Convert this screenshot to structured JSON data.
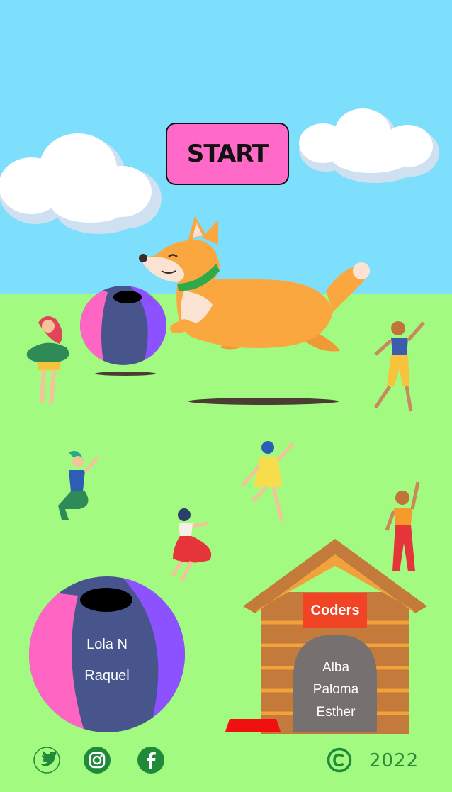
{
  "start_label": "START",
  "colors": {
    "sky": "#7ddffb",
    "grass": "#a2fb80",
    "button": "#ff6ac9",
    "sign": "#f04424",
    "door": "#777070",
    "icon_green": "#1e8a3a"
  },
  "team_ball": {
    "names": [
      "Lola N",
      "Raquel"
    ]
  },
  "dog_house": {
    "sign": "Coders",
    "names": [
      "Alba",
      "Paloma",
      "Esther"
    ]
  },
  "footer": {
    "icons": [
      "twitter-icon",
      "instagram-icon",
      "facebook-icon"
    ],
    "copyright_icon": "copyright-icon",
    "year": "2022"
  }
}
